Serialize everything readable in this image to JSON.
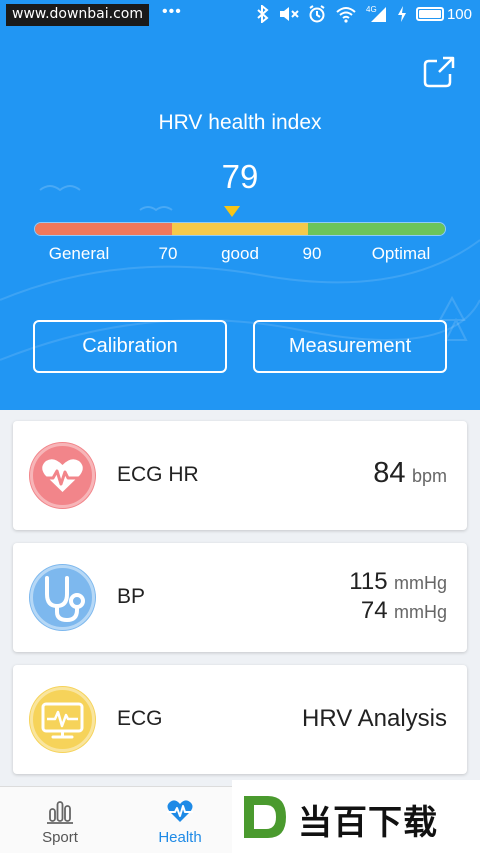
{
  "status_bar": {
    "watermark": "www.downbai.com",
    "dots": "•••",
    "signal_label": "4G",
    "battery": "100"
  },
  "header": {
    "title": "HRV health index",
    "value": "79",
    "value_fraction": 0.48,
    "scale_labels": [
      "General",
      "70",
      "good",
      "90",
      "Optimal"
    ],
    "scale_colors": [
      "#f0785a",
      "#f5c94a",
      "#6cc45a"
    ],
    "calibration_label": "Calibration",
    "measurement_label": "Measurement"
  },
  "cards": {
    "ecg_hr": {
      "title": "ECG HR",
      "value": "84",
      "unit": "bpm"
    },
    "bp": {
      "title": "BP",
      "systolic": "115",
      "diastolic": "74",
      "unit": "mmHg"
    },
    "ecg": {
      "title": "ECG",
      "value": "HRV Analysis"
    }
  },
  "bottom_nav": {
    "items": [
      {
        "label": "Sport",
        "icon": "bar-chart-icon"
      },
      {
        "label": "Health",
        "icon": "heartbeat-icon"
      }
    ]
  },
  "logo": {
    "text": "当百下载",
    "mark": "D"
  },
  "colors": {
    "header_blue": "#2196f3",
    "accent": "#1e8ae6",
    "pointer": "#f5c518"
  }
}
